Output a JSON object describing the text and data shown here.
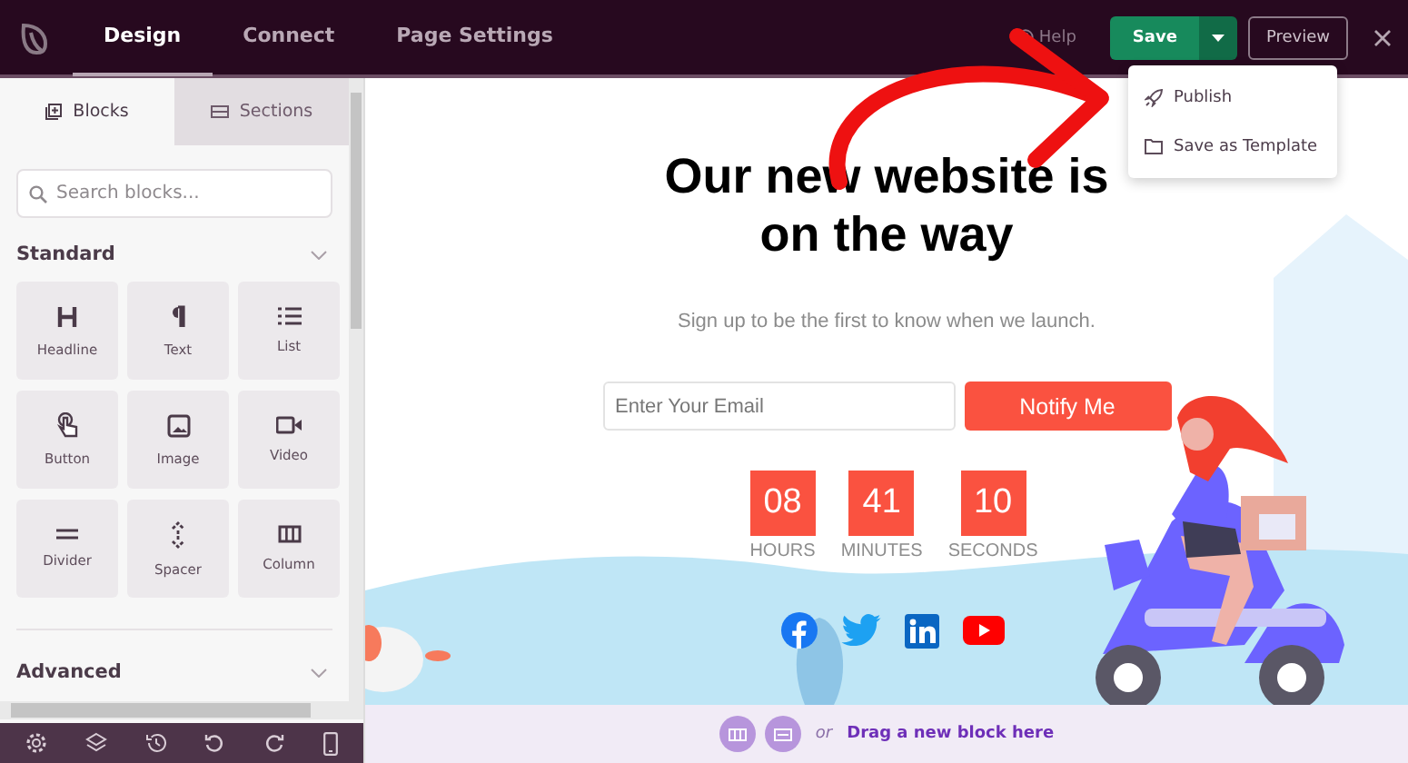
{
  "topbar": {
    "tabs": [
      {
        "label": "Design",
        "selected": true
      },
      {
        "label": "Connect",
        "selected": false
      },
      {
        "label": "Page Settings",
        "selected": false
      }
    ],
    "help": "Help",
    "save": "Save",
    "preview": "Preview"
  },
  "save_menu": [
    {
      "label": "Publish",
      "kind": "publish"
    },
    {
      "label": "Save as Template",
      "kind": "template"
    }
  ],
  "sidebar": {
    "tabs": [
      {
        "label": "Blocks",
        "kind": "blocks",
        "selected": true
      },
      {
        "label": "Sections",
        "kind": "sections",
        "selected": false
      }
    ],
    "search_placeholder": "Search blocks...",
    "sections": [
      {
        "title": "Standard",
        "blocks": [
          {
            "label": "Headline",
            "kind": "headline"
          },
          {
            "label": "Text",
            "kind": "text"
          },
          {
            "label": "List",
            "kind": "list"
          },
          {
            "label": "Button",
            "kind": "button"
          },
          {
            "label": "Image",
            "kind": "image"
          },
          {
            "label": "Video",
            "kind": "video"
          },
          {
            "label": "Divider",
            "kind": "divider"
          },
          {
            "label": "Spacer",
            "kind": "spacer"
          },
          {
            "label": "Column",
            "kind": "column"
          }
        ]
      },
      {
        "title": "Advanced"
      }
    ]
  },
  "page": {
    "headline": "Our new website is on the way",
    "subtitle": "Sign up to be the first to know when we launch.",
    "email_placeholder": "Enter Your Email",
    "button": "Notify Me",
    "countdown": [
      {
        "value": "08",
        "label": "HOURS"
      },
      {
        "value": "41",
        "label": "MINUTES"
      },
      {
        "value": "10",
        "label": "SECONDS"
      }
    ],
    "social": [
      {
        "kind": "facebook"
      },
      {
        "kind": "twitter"
      },
      {
        "kind": "linkedin"
      },
      {
        "kind": "youtube"
      }
    ]
  },
  "drop_zone": {
    "or": "or",
    "text": "Drag a new block here"
  }
}
